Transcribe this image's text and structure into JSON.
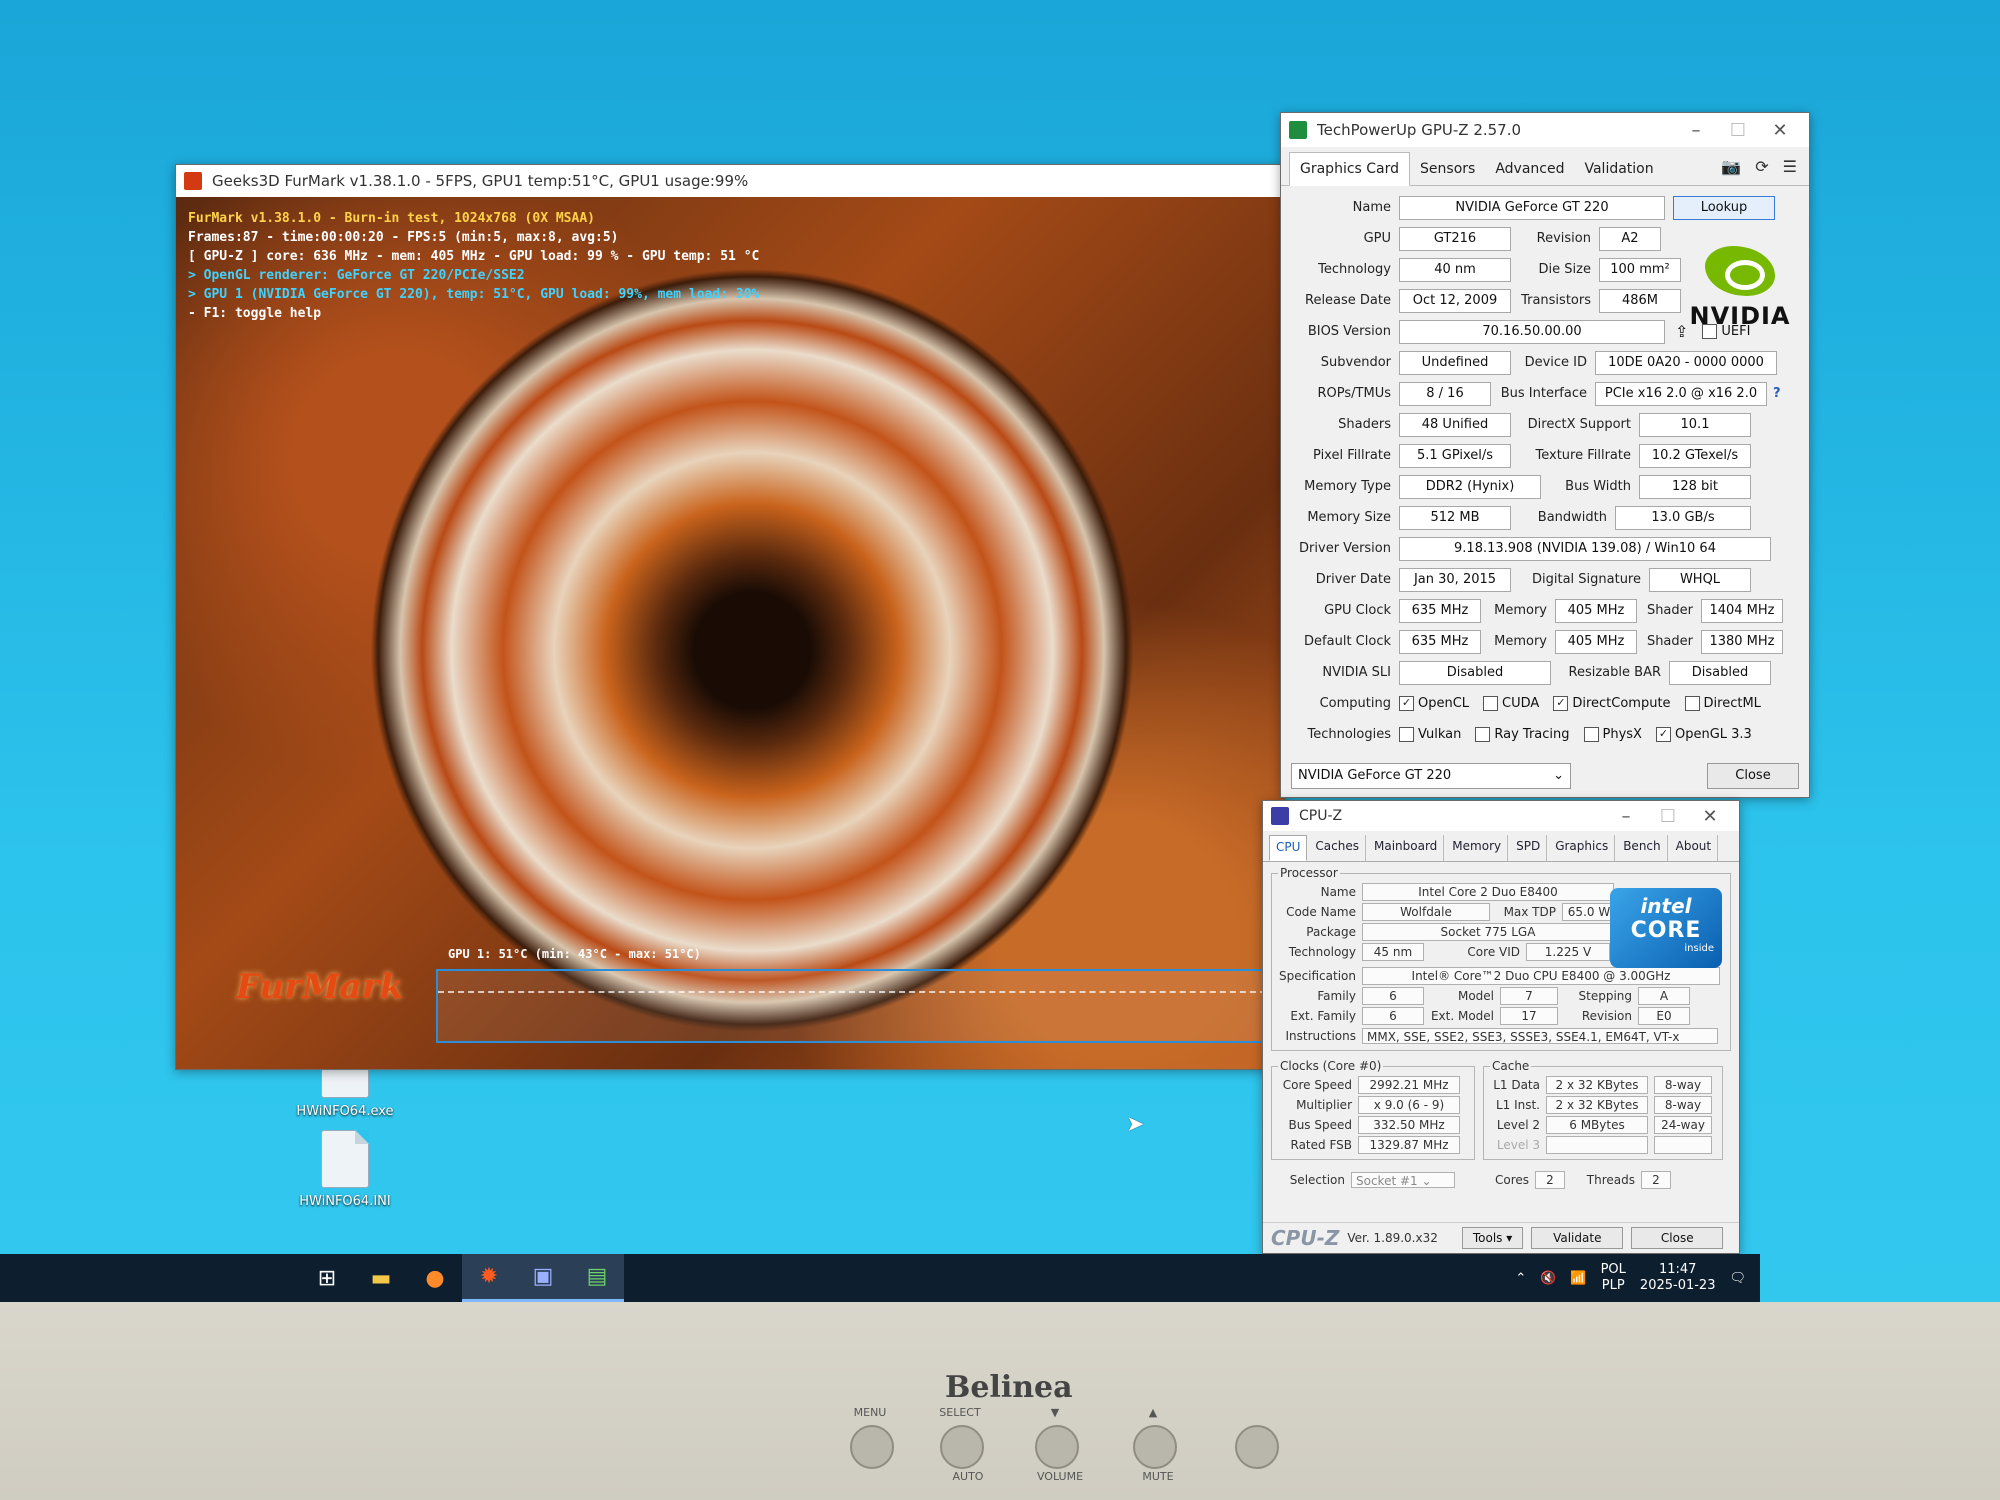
{
  "desktop": {
    "icons": [
      {
        "label": "HWiNFO64.exe"
      },
      {
        "label": "HWiNFO64.INI"
      }
    ]
  },
  "furmark": {
    "title": "Geeks3D FurMark v1.38.1.0 - 5FPS, GPU1 temp:51°C, GPU1 usage:99%",
    "overlay": [
      "FurMark v1.38.1.0 - Burn-in test, 1024x768 (0X MSAA)",
      "Frames:87 - time:00:00:20 - FPS:5 (min:5, max:8, avg:5)",
      "[ GPU-Z ] core: 636 MHz - mem: 405 MHz - GPU load: 99 % - GPU temp: 51 °C",
      "> OpenGL renderer: GeForce GT 220/PCIe/SSE2",
      "> GPU 1 (NVIDIA GeForce GT 220), temp: 51°C, GPU load: 99%, mem load: 30%",
      "- F1: toggle help"
    ],
    "graph_label": "GPU 1: 51°C (min: 43°C - max: 51°C)",
    "logo": "FurMark"
  },
  "gpuz": {
    "title": "TechPowerUp GPU-Z 2.57.0",
    "tabs": [
      "Graphics Card",
      "Sensors",
      "Advanced",
      "Validation"
    ],
    "lookup_label": "Lookup",
    "logo_text": "NVIDIA",
    "fields": {
      "name": "NVIDIA GeForce GT 220",
      "gpu": "GT216",
      "revision": "A2",
      "technology": "40 nm",
      "die_size": "100 mm²",
      "release_date": "Oct 12, 2009",
      "transistors": "486M",
      "bios_version": "70.16.50.00.00",
      "uefi": "UEFI",
      "subvendor": "Undefined",
      "device_id": "10DE 0A20 - 0000 0000",
      "rops_tmus": "8 / 16",
      "bus_interface": "PCIe x16 2.0 @ x16 2.0",
      "shaders": "48 Unified",
      "directx_support": "10.1",
      "pixel_fillrate": "5.1 GPixel/s",
      "texture_fillrate": "10.2 GTexel/s",
      "memory_type": "DDR2 (Hynix)",
      "bus_width": "128 bit",
      "memory_size": "512 MB",
      "bandwidth": "13.0 GB/s",
      "driver_version": "9.18.13.908 (NVIDIA 139.08) / Win10 64",
      "driver_date": "Jan 30, 2015",
      "digital_signature": "WHQL",
      "gpu_clock": "635 MHz",
      "gpu_memory": "405 MHz",
      "gpu_shader": "1404 MHz",
      "default_clock": "635 MHz",
      "default_memory": "405 MHz",
      "default_shader": "1380 MHz",
      "nvidia_sli": "Disabled",
      "resizable_bar": "Disabled"
    },
    "labels": {
      "name": "Name",
      "gpu": "GPU",
      "revision": "Revision",
      "technology": "Technology",
      "die_size": "Die Size",
      "release_date": "Release Date",
      "transistors": "Transistors",
      "bios_version": "BIOS Version",
      "subvendor": "Subvendor",
      "device_id": "Device ID",
      "rops_tmus": "ROPs/TMUs",
      "bus_interface": "Bus Interface",
      "shaders": "Shaders",
      "directx_support": "DirectX Support",
      "pixel_fillrate": "Pixel Fillrate",
      "texture_fillrate": "Texture Fillrate",
      "memory_type": "Memory Type",
      "bus_width": "Bus Width",
      "memory_size": "Memory Size",
      "bandwidth": "Bandwidth",
      "driver_version": "Driver Version",
      "driver_date": "Driver Date",
      "digital_signature": "Digital Signature",
      "gpu_clock": "GPU Clock",
      "memory": "Memory",
      "shader": "Shader",
      "default_clock": "Default Clock",
      "nvidia_sli": "NVIDIA SLI",
      "resizable_bar": "Resizable BAR",
      "computing": "Computing",
      "technologies": "Technologies"
    },
    "computing": [
      {
        "label": "OpenCL",
        "checked": true
      },
      {
        "label": "CUDA",
        "checked": false
      },
      {
        "label": "DirectCompute",
        "checked": true
      },
      {
        "label": "DirectML",
        "checked": false
      }
    ],
    "technologies": [
      {
        "label": "Vulkan",
        "checked": false
      },
      {
        "label": "Ray Tracing",
        "checked": false
      },
      {
        "label": "PhysX",
        "checked": false
      },
      {
        "label": "OpenGL 3.3",
        "checked": true
      }
    ],
    "select_value": "NVIDIA GeForce GT 220",
    "close_label": "Close"
  },
  "cpuz": {
    "title": "CPU-Z",
    "tabs": [
      "CPU",
      "Caches",
      "Mainboard",
      "Memory",
      "SPD",
      "Graphics",
      "Bench",
      "About"
    ],
    "processor_legend": "Processor",
    "labels": {
      "name": "Name",
      "code_name": "Code Name",
      "max_tdp": "Max TDP",
      "package": "Package",
      "technology": "Technology",
      "core_vid": "Core VID",
      "specification": "Specification",
      "family": "Family",
      "model": "Model",
      "stepping": "Stepping",
      "ext_family": "Ext. Family",
      "ext_model": "Ext. Model",
      "revision": "Revision",
      "instructions": "Instructions",
      "core_speed": "Core Speed",
      "multiplier": "Multiplier",
      "bus_speed": "Bus Speed",
      "rated_fsb": "Rated FSB",
      "l1_data": "L1 Data",
      "l1_inst": "L1 Inst.",
      "level2": "Level 2",
      "level3": "Level 3",
      "selection": "Selection",
      "cores": "Cores",
      "threads": "Threads"
    },
    "processor": {
      "name": "Intel Core 2 Duo E8400",
      "code_name": "Wolfdale",
      "max_tdp": "65.0 W",
      "package": "Socket 775 LGA",
      "technology": "45 nm",
      "core_vid": "1.225 V",
      "specification": "Intel® Core™2 Duo CPU    E8400  @ 3.00GHz",
      "family": "6",
      "model": "7",
      "stepping": "A",
      "ext_family": "6",
      "ext_model": "17",
      "revision": "E0",
      "instructions": "MMX, SSE, SSE2, SSE3, SSSE3, SSE4.1, EM64T, VT-x"
    },
    "clocks_legend": "Clocks (Core #0)",
    "clocks": {
      "core_speed": "2992.21 MHz",
      "multiplier": "x 9.0 (6 - 9)",
      "bus_speed": "332.50 MHz",
      "rated_fsb": "1329.87 MHz"
    },
    "cache_legend": "Cache",
    "cache": {
      "l1_data": "2 x 32 KBytes",
      "l1_data_way": "8-way",
      "l1_inst": "2 x 32 KBytes",
      "l1_inst_way": "8-way",
      "level2": "6 MBytes",
      "level2_way": "24-way"
    },
    "selection": "Socket #1",
    "cores": "2",
    "threads": "2",
    "intel_logo": {
      "line1": "intel",
      "line2": "CORE",
      "line3": "inside"
    },
    "footer": {
      "brand": "CPU-Z",
      "version": "Ver. 1.89.0.x32",
      "tools": "Tools",
      "validate": "Validate",
      "close": "Close"
    }
  },
  "taskbar": {
    "tray": {
      "lang_top": "POL",
      "lang_bottom": "PLP",
      "time": "11:47",
      "date": "2025-01-23"
    }
  },
  "monitor": {
    "brand": "Belinea",
    "buttons": [
      "MENU",
      "SELECT",
      "▼",
      "▲"
    ],
    "sublabels": [
      "AUTO",
      "VOLUME",
      "MUTE"
    ]
  },
  "colors": {
    "desktop": "#2cc3ec",
    "nvidia_green": "#76b900",
    "intel_blue": "#0a5fb0"
  }
}
